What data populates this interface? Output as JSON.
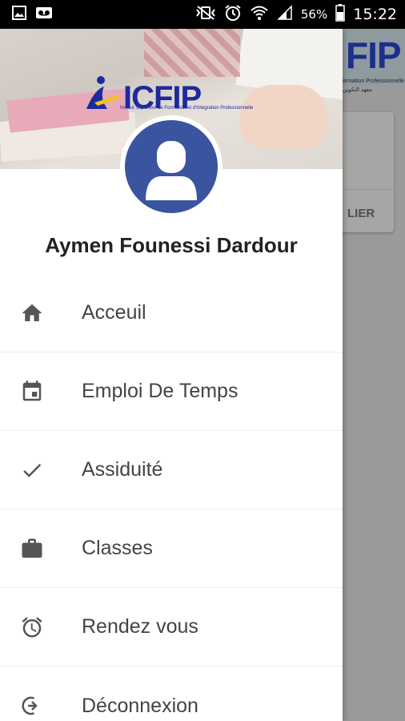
{
  "status_bar": {
    "battery": "56%",
    "time": "15:22"
  },
  "background_app": {
    "logo": "FIP",
    "subtitle": "ormation Professionnelle",
    "subtitle2": "معهد التكوين",
    "button": "LIER"
  },
  "drawer": {
    "logo_text": "ICFIP",
    "logo_sub": "Institut Supérieur de Formation et d'Intégration Professionnelle",
    "user_name": "Aymen Founessi Dardour",
    "menu": [
      {
        "label": "Acceuil",
        "icon": "home-icon"
      },
      {
        "label": "Emploi De Temps",
        "icon": "calendar-icon"
      },
      {
        "label": "Assiduité",
        "icon": "check-icon"
      },
      {
        "label": "Classes",
        "icon": "briefcase-icon"
      },
      {
        "label": "Rendez vous",
        "icon": "alarm-icon"
      },
      {
        "label": "Déconnexion",
        "icon": "logout-icon"
      }
    ]
  },
  "colors": {
    "avatar_bg": "#3a54a0",
    "logo_blue": "#1d2a9c",
    "scrim": "#9e9e9e"
  }
}
